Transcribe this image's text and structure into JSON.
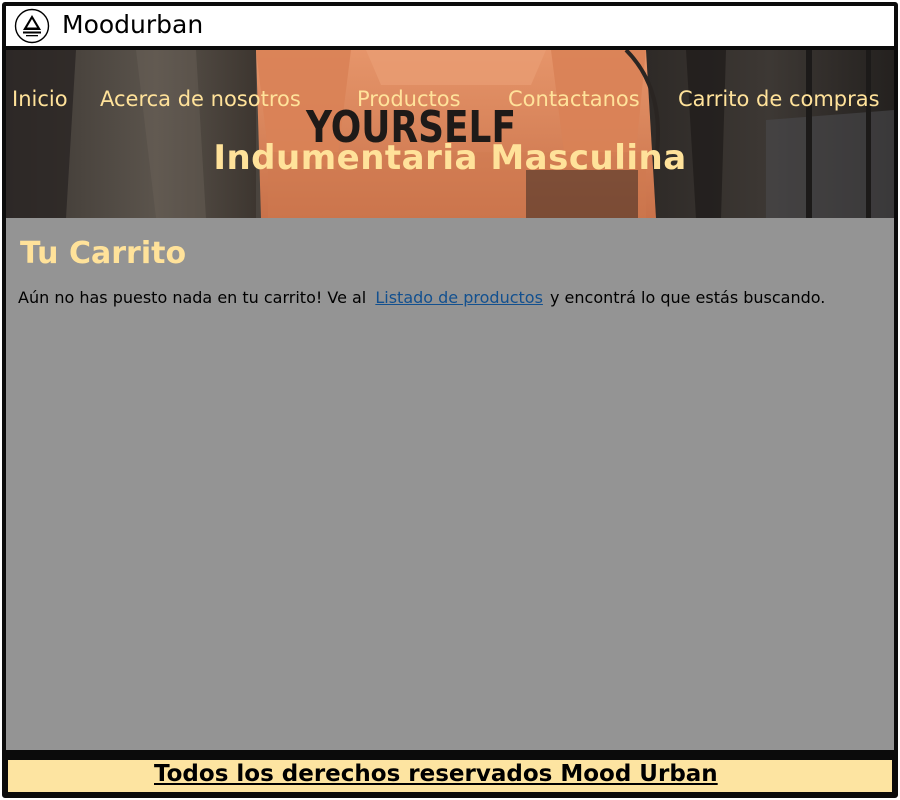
{
  "brand": {
    "name": "Moodurban",
    "logo_icon": "pyramid-logo-icon"
  },
  "nav": {
    "items": [
      {
        "label": "Inicio"
      },
      {
        "label": "Acerca de nosotros"
      },
      {
        "label": "Productos"
      },
      {
        "label": "Contactanos"
      },
      {
        "label": "Carrito de compras"
      }
    ]
  },
  "hero": {
    "title": "Indumentaria Masculina",
    "image_text": "YOURSELF"
  },
  "cart": {
    "title": "Tu Carrito",
    "message_before": "Aún no has puesto nada en tu carrito! Ve al",
    "link_label": "Listado de productos",
    "message_after": "y encontrá lo que estás buscando."
  },
  "footer": {
    "text": "Todos los derechos reservados Mood Urban"
  },
  "colors": {
    "accent_text": "#ffe29a",
    "main_bg": "#949494",
    "footer_bg": "#fde4a1",
    "link": "#12508f",
    "frame": "#0b0b0b"
  }
}
